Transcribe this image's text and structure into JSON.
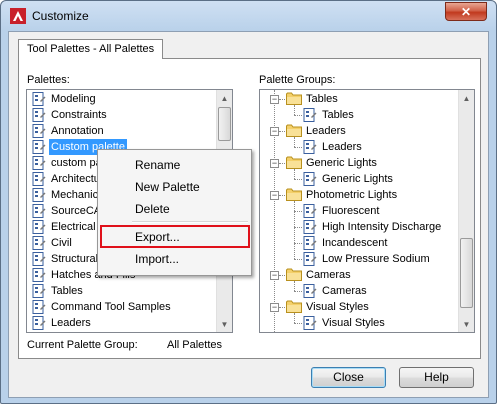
{
  "window": {
    "title": "Customize",
    "close_glyph": "✕"
  },
  "tab": {
    "label": "Tool Palettes - All Palettes"
  },
  "palettes": {
    "label": "Palettes:",
    "items": [
      "Modeling",
      "Constraints",
      "Annotation",
      "Custom palette",
      "custom pa",
      "Architectu",
      "Mechanic",
      "SourceCA",
      "Electrical",
      "Civil",
      "Structural",
      "Hatches and Fills",
      "Tables",
      "Command Tool Samples",
      "Leaders"
    ],
    "selected": "Custom palette"
  },
  "palette_groups": {
    "label": "Palette Groups:",
    "groups": [
      {
        "name": "Tables",
        "children": [
          "Tables"
        ]
      },
      {
        "name": "Leaders",
        "children": [
          "Leaders"
        ]
      },
      {
        "name": "Generic Lights",
        "children": [
          "Generic Lights"
        ]
      },
      {
        "name": "Photometric Lights",
        "children": [
          "Fluorescent",
          "High Intensity Discharge",
          "Incandescent",
          "Low Pressure Sodium"
        ]
      },
      {
        "name": "Cameras",
        "children": [
          "Cameras"
        ]
      },
      {
        "name": "Visual Styles",
        "children": [
          "Visual Styles"
        ]
      }
    ],
    "expander_glyph": "−"
  },
  "context_menu": {
    "items": [
      "Rename",
      "New Palette",
      "Delete",
      "Export...",
      "Import..."
    ],
    "highlighted": "Export..."
  },
  "current_group": {
    "label": "Current Palette Group:",
    "value": "All Palettes"
  },
  "buttons": {
    "close": "Close",
    "help": "Help"
  },
  "colors": {
    "selection": "#3399ff",
    "highlight_box": "#e0101a",
    "title_bar": "#b9d1ea"
  }
}
